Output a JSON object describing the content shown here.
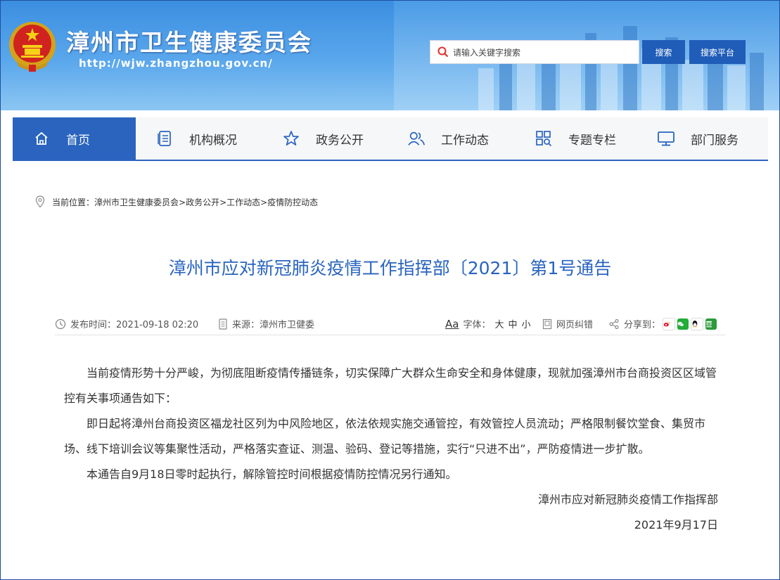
{
  "header": {
    "site_title": "漳州市卫生健康委员会",
    "site_url": "http://wjw.zhangzhou.gov.cn/",
    "search_placeholder": "请输入关键字搜索",
    "search_button": "搜索",
    "search_platform_button": "搜索平台"
  },
  "nav": {
    "items": [
      {
        "label": "首页",
        "icon": "home-icon"
      },
      {
        "label": "机构概况",
        "icon": "document-list-icon"
      },
      {
        "label": "政务公开",
        "icon": "star-icon"
      },
      {
        "label": "工作动态",
        "icon": "users-icon"
      },
      {
        "label": "专题专栏",
        "icon": "grid-search-icon"
      },
      {
        "label": "部门服务",
        "icon": "monitor-icon"
      }
    ]
  },
  "breadcrumb": {
    "prefix": "当前位置：",
    "path": "漳州市卫生健康委员会>政务公开>工作动态>疫情防控动态"
  },
  "article": {
    "title": "漳州市应对新冠肺炎疫情工作指挥部〔2021〕第1号通告",
    "meta": {
      "publish_time": "发布时间：2021-09-18 02:20",
      "source": "来源：漳州市卫健委",
      "font_label": "字体：",
      "font_sizes": [
        "大",
        "中",
        "小"
      ],
      "font_icon_text": "Aa",
      "correction": "网页纠错",
      "share_label": "分享到："
    },
    "paragraphs": [
      "当前疫情形势十分严峻，为彻底阻断疫情传播链条，切实保障广大群众生命安全和身体健康，现就加强漳州市台商投资区区域管控有关事项通告如下：",
      "即日起将漳州台商投资区福龙社区列为中风险地区，依法依规实施交通管控，有效管控人员流动；严格限制餐饮堂食、集贸市场、线下培训会议等集聚性活动，严格落实查证、测温、验码、登记等措施，实行“只进不出”，严防疫情进一步扩散。",
      "本通告自9月18日零时起执行，解除管控时间根据疫情防控情况另行通知。"
    ],
    "signature": "漳州市应对新冠肺炎疫情工作指挥部",
    "date": "2021年9月17日"
  },
  "colors": {
    "primary_blue": "#2a64bf",
    "header_blue": "#3b8ee0",
    "title_blue": "#2a64bf"
  }
}
